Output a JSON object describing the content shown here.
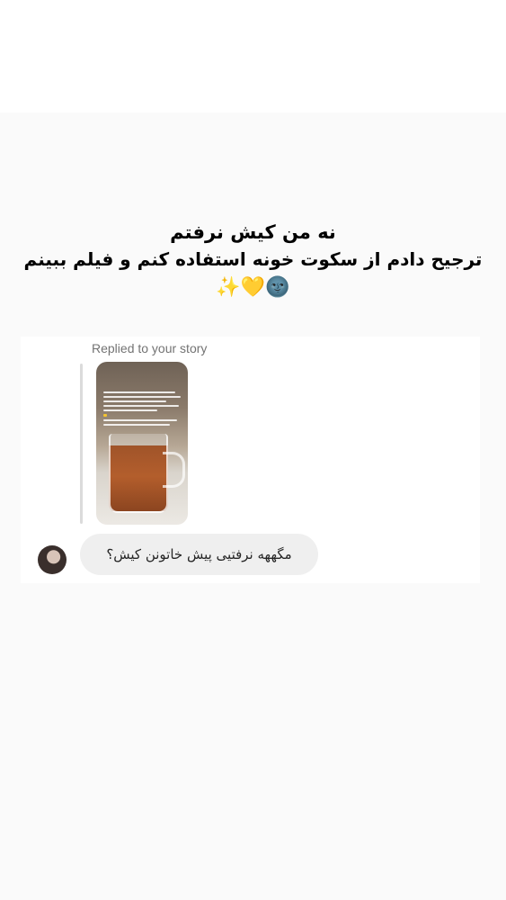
{
  "caption": {
    "line1": "نه من کیش نرفتم",
    "line2": "ترجیح دادم از سکوت خونه استفاده کنم و فیلم ببینم",
    "emojis": {
      "moon": "🌚",
      "heart": "💛",
      "sparkles": "✨"
    }
  },
  "reply": {
    "label": "Replied to your story"
  },
  "message": {
    "text": "مگههه نرفتیی پیش خاتونن کیش؟"
  },
  "colors": {
    "background": "#fafafa",
    "bubble": "#efefef",
    "meta_text": "#737373"
  }
}
